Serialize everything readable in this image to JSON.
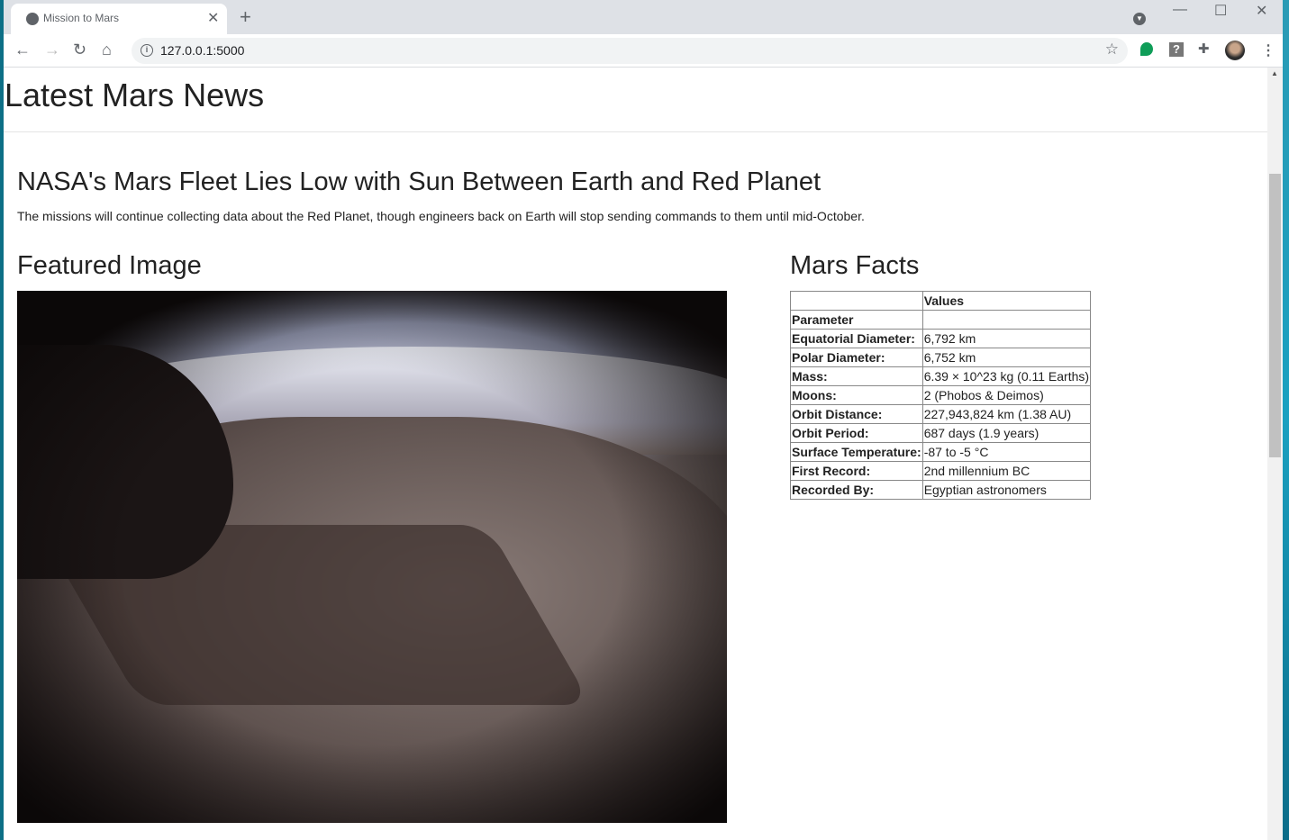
{
  "browser": {
    "tab_title": "Mission to Mars",
    "url": "127.0.0.1:5000"
  },
  "page": {
    "heading": "Latest Mars News",
    "news_title": "NASA's Mars Fleet Lies Low with Sun Between Earth and Red Planet",
    "news_paragraph": "The missions will continue collecting data about the Red Planet, though engineers back on Earth will stop sending commands to them until mid-October.",
    "featured_heading": "Featured Image",
    "facts_heading": "Mars Facts",
    "facts_table": {
      "header": [
        "",
        "Values"
      ],
      "index_label": "Parameter",
      "rows": [
        {
          "k": "Equatorial Diameter:",
          "v": "6,792 km"
        },
        {
          "k": "Polar Diameter:",
          "v": "6,752 km"
        },
        {
          "k": "Mass:",
          "v": "6.39 × 10^23 kg (0.11 Earths)"
        },
        {
          "k": "Moons:",
          "v": "2 (Phobos & Deimos)"
        },
        {
          "k": "Orbit Distance:",
          "v": "227,943,824 km (1.38 AU)"
        },
        {
          "k": "Orbit Period:",
          "v": "687 days (1.9 years)"
        },
        {
          "k": "Surface Temperature:",
          "v": "-87 to -5 °C"
        },
        {
          "k": "First Record:",
          "v": "2nd millennium BC"
        },
        {
          "k": "Recorded By:",
          "v": "Egyptian astronomers"
        }
      ]
    }
  }
}
